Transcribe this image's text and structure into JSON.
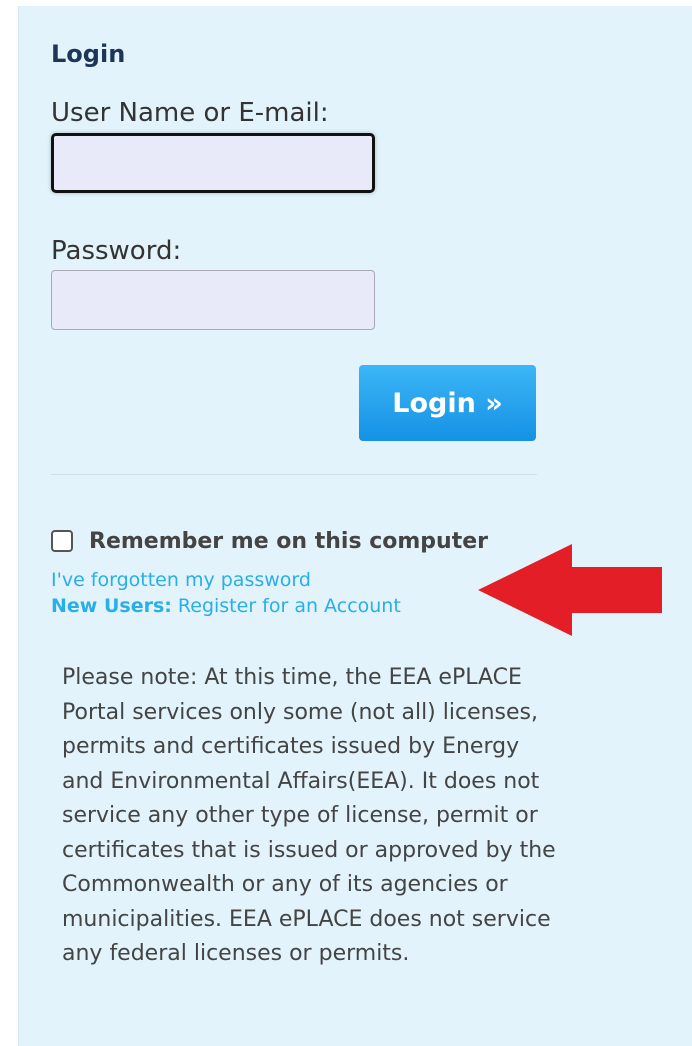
{
  "login": {
    "title": "Login",
    "username_label": "User Name or E-mail:",
    "username_value": "",
    "password_label": "Password:",
    "password_value": "",
    "button_label": "Login »",
    "remember_label": "Remember me on this computer",
    "remember_checked": false,
    "forgot_link": "I've forgotten my password",
    "new_users_label": "New Users:",
    "register_link": "Register for an Account"
  },
  "note": "Please note: At this time, the EEA ePLACE Portal services only some (not all) licenses, permits and certificates issued by Energy and Environmental Affairs(EEA). It does not service any other type of license, permit or certificates that is issued or approved by the Commonwealth or any of its agencies or municipalities. EEA ePLACE does not service any federal licenses or permits.",
  "colors": {
    "panel_background": "#e2f3fb",
    "title_color": "#1d3658",
    "button_color": "#2aa4ee",
    "link_color": "#2aaee8",
    "arrow_color": "#e41e26"
  },
  "icons": {
    "annotation": "red-arrow-left-icon"
  }
}
